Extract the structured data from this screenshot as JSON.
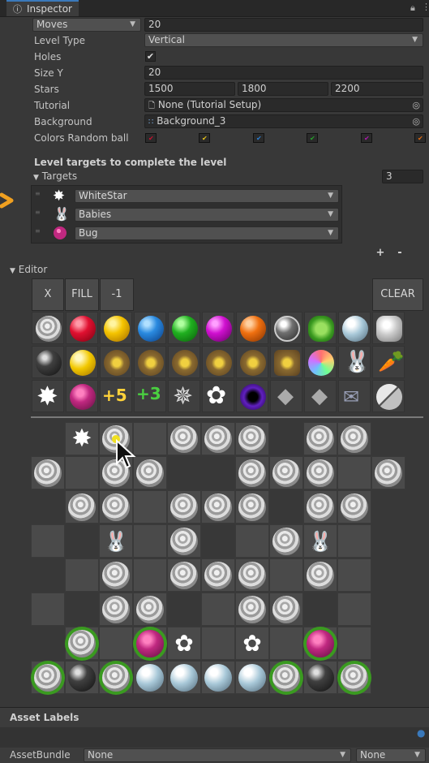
{
  "tab": {
    "title": "Inspector"
  },
  "fields": {
    "moves": {
      "label": "Moves",
      "value": "20"
    },
    "level_type": {
      "label": "Level Type",
      "value": "Vertical"
    },
    "holes": {
      "label": "Holes",
      "checked": true
    },
    "size_y": {
      "label": "Size Y",
      "value": "20"
    },
    "stars": {
      "label": "Stars",
      "values": [
        "1500",
        "1800",
        "2200"
      ]
    },
    "tutorial": {
      "label": "Tutorial",
      "value": "None (Tutorial Setup)"
    },
    "background": {
      "label": "Background",
      "value": "Background_3"
    },
    "colors_random_ball": {
      "label": "Colors Random ball",
      "colors": [
        "#c8102e",
        "#e6c21a",
        "#2a7fd4",
        "#26a32a",
        "#b01ab0",
        "#e06a10"
      ]
    }
  },
  "targets_section": {
    "heading": "Level targets to complete the level",
    "foldout": "Targets",
    "count": "3",
    "items": [
      {
        "label": "WhiteStar",
        "icon": "white-star-icon"
      },
      {
        "label": "Babies",
        "icon": "bunny-icon"
      },
      {
        "label": "Bug",
        "icon": "ladybug-icon"
      }
    ],
    "add_label": "+",
    "remove_label": "-"
  },
  "editor": {
    "foldout": "Editor",
    "buttons": {
      "x": "X",
      "fill": "FILL",
      "minus_one": "-1",
      "clear": "CLEAR"
    },
    "palette_badges": {
      "plus5": "+5",
      "plus3": "+3"
    }
  },
  "footer": {
    "asset_labels": "Asset Labels",
    "asset_bundle_label": "AssetBundle",
    "asset_bundle_value": "None",
    "asset_variant_value": "None"
  },
  "colors": {
    "accent": "#3a79bb",
    "arrow": "#f0a020"
  }
}
